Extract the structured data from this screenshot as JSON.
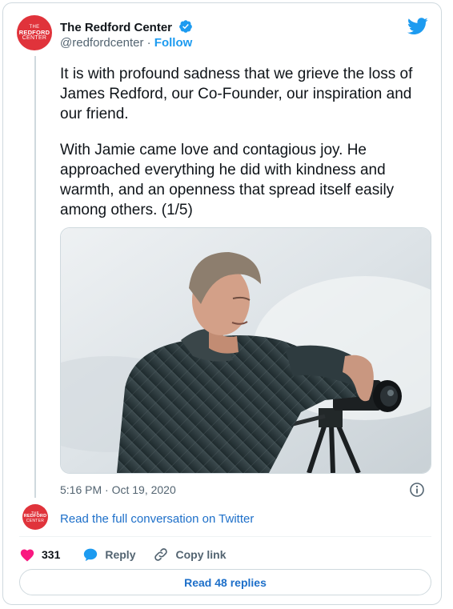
{
  "colors": {
    "brand_red": "#e0333b",
    "twitter_blue": "#1d9bf0",
    "like_red": "#f91880",
    "muted": "#536471"
  },
  "account": {
    "name": "The Redford Center",
    "handle": "@redfordcenter",
    "separator": "·",
    "follow_label": "Follow",
    "avatar_line1": "THE",
    "avatar_line2": "REDFORD",
    "avatar_line3": "CENTER"
  },
  "tweet": {
    "paragraph1": "It is with profound sadness that we grieve the loss of James Redford, our Co-Founder, our inspiration and our friend.",
    "paragraph2": "With Jamie came love and contagious joy. He approached everything he did with kindness and warmth, and an openness that spread itself easily among others. (1/5)",
    "timestamp": "5:16 PM · Oct 19, 2020"
  },
  "conversation": {
    "label": "Read the full conversation on Twitter"
  },
  "actions": {
    "like_count": "331",
    "reply_label": "Reply",
    "copy_label": "Copy link"
  },
  "replies_button": {
    "label": "Read 48 replies"
  },
  "icons": [
    "verified-badge-icon",
    "twitter-bird-icon",
    "info-icon",
    "heart-icon",
    "reply-bubble-icon",
    "link-icon"
  ]
}
